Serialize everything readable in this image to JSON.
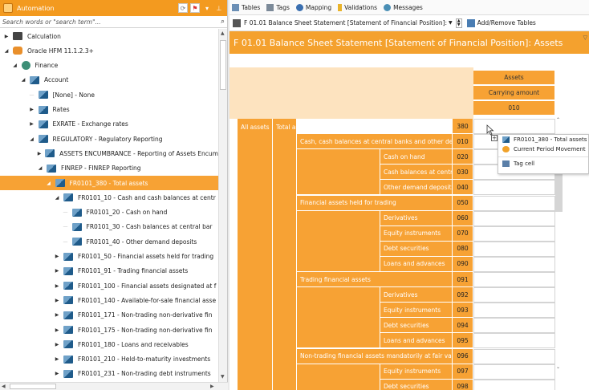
{
  "left_panel": {
    "title": "Automation",
    "search_placeholder": "Search words or \"search term\"...",
    "tree": [
      {
        "label": "Calculation",
        "indent": 0,
        "icon": "calculator-icon",
        "arrow": "▶"
      },
      {
        "label": "Oracle HFM 11.1.2.3+",
        "indent": 0,
        "icon": "oracle-icon",
        "arrow": "◢"
      },
      {
        "label": "Finance",
        "indent": 1,
        "icon": "globe-icon",
        "arrow": "◢"
      },
      {
        "label": "Account",
        "indent": 2,
        "icon": "dimension-icon",
        "arrow": "◢"
      },
      {
        "label": "[None] - None",
        "indent": 3,
        "icon": "dimension-icon",
        "arrow": ""
      },
      {
        "label": "Rates",
        "indent": 3,
        "icon": "dimension-icon",
        "arrow": "▶"
      },
      {
        "label": "EXRATE - Exchange rates",
        "indent": 3,
        "icon": "dimension-icon",
        "arrow": "▶"
      },
      {
        "label": "REGULATORY - Regulatory Reporting",
        "indent": 3,
        "icon": "dimension-icon",
        "arrow": "◢"
      },
      {
        "label": "ASSETS ENCUMBRANCE - Reporting of Assets Encum",
        "indent": 4,
        "icon": "dimension-icon",
        "arrow": "▶"
      },
      {
        "label": "FINREP - FINREP Reporting",
        "indent": 4,
        "icon": "dimension-icon",
        "arrow": "◢"
      },
      {
        "label": "FR0101_380 - Total assets",
        "indent": 5,
        "icon": "dimension-icon",
        "arrow": "◢",
        "selected": true
      },
      {
        "label": "FR0101_10 - Cash and cash balances at centr",
        "indent": 6,
        "icon": "dimension-icon",
        "arrow": "◢"
      },
      {
        "label": "FR0101_20 - Cash on hand",
        "indent": 7,
        "icon": "dimension-icon",
        "arrow": ""
      },
      {
        "label": "FR0101_30 - Cash balances at central bar",
        "indent": 7,
        "icon": "dimension-icon",
        "arrow": ""
      },
      {
        "label": "FR0101_40 - Other demand deposits",
        "indent": 7,
        "icon": "dimension-icon",
        "arrow": ""
      },
      {
        "label": "FR0101_50 - Financial assets held for trading",
        "indent": 6,
        "icon": "dimension-icon",
        "arrow": "▶"
      },
      {
        "label": "FR0101_91 - Trading financial assets",
        "indent": 6,
        "icon": "dimension-icon",
        "arrow": "▶"
      },
      {
        "label": "FR0101_100 - Financial assets designated at f",
        "indent": 6,
        "icon": "dimension-icon",
        "arrow": "▶"
      },
      {
        "label": "FR0101_140 - Available-for-sale financial asse",
        "indent": 6,
        "icon": "dimension-icon",
        "arrow": "▶"
      },
      {
        "label": "FR0101_171 - Non-trading non-derivative fin",
        "indent": 6,
        "icon": "dimension-icon",
        "arrow": "▶"
      },
      {
        "label": "FR0101_175 - Non-trading non-derivative fin",
        "indent": 6,
        "icon": "dimension-icon",
        "arrow": "▶"
      },
      {
        "label": "FR0101_180 - Loans and receivables",
        "indent": 6,
        "icon": "dimension-icon",
        "arrow": "▶"
      },
      {
        "label": "FR0101_210 - Held-to-maturity investments",
        "indent": 6,
        "icon": "dimension-icon",
        "arrow": "▶"
      },
      {
        "label": "FR0101_231 - Non-trading debt instruments",
        "indent": 6,
        "icon": "dimension-icon",
        "arrow": "▶"
      }
    ]
  },
  "tabs": [
    "Tables",
    "Tags",
    "Mapping",
    "Validations",
    "Messages"
  ],
  "toolbar": {
    "table_select": "F 01.01 Balance Sheet Statement [Statement of Financial Position]:",
    "add_remove": "Add/Remove Tables"
  },
  "table": {
    "title": "F 01.01 Balance Sheet Statement [Statement of Financial Position]: Assets",
    "col_header_1": "Assets",
    "col_header_2": "Carrying amount",
    "col_code": "010",
    "axis_label": "All assets",
    "total_label": "Total assets",
    "rows": [
      {
        "label": "Total assets",
        "code": "380"
      },
      {
        "label": "Cash, cash balances at central banks and other dema...",
        "code": "010"
      },
      {
        "label": "Cash on hand",
        "code": "020"
      },
      {
        "label": "Cash balances at central...",
        "code": "030"
      },
      {
        "label": "Other demand deposits",
        "code": "040"
      },
      {
        "label": "Financial assets held for trading",
        "code": "050"
      },
      {
        "label": "Derivatives",
        "code": "060"
      },
      {
        "label": "Equity instruments",
        "code": "070"
      },
      {
        "label": "Debt securities",
        "code": "080"
      },
      {
        "label": "Loans and advances",
        "code": "090"
      },
      {
        "label": "Trading financial assets",
        "code": "091"
      },
      {
        "label": "Derivatives",
        "code": "092"
      },
      {
        "label": "Equity instruments",
        "code": "093"
      },
      {
        "label": "Debt securities",
        "code": "094"
      },
      {
        "label": "Loans and advances",
        "code": "095"
      },
      {
        "label": "Non-trading financial assets mandatorily at fair value...",
        "code": "096"
      },
      {
        "label": "Equity instruments",
        "code": "097"
      },
      {
        "label": "Debt securities",
        "code": "098"
      }
    ]
  },
  "popup": {
    "item1": "FR0101_380 - Total assets",
    "item2": "Current Period Movement",
    "item3": "Tag cell"
  },
  "colors": {
    "accent": "#f7a234",
    "header": "#f4a12e"
  }
}
